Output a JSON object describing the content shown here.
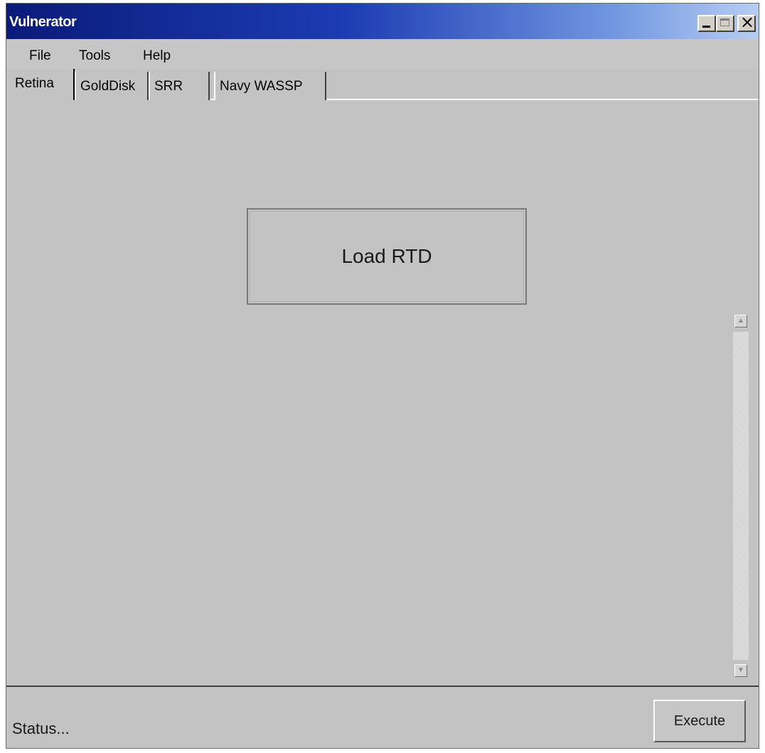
{
  "window": {
    "title": "Vulnerator",
    "controls": {
      "minimize": "minimize-icon",
      "maximize": "maximize-icon",
      "close": "close-icon"
    }
  },
  "menu": {
    "items": [
      {
        "label": "File"
      },
      {
        "label": "Tools"
      },
      {
        "label": "Help"
      }
    ]
  },
  "tabs": {
    "active": "Retina",
    "items": [
      {
        "label": "Retina"
      },
      {
        "label": "GoldDisk"
      },
      {
        "label": "SRR"
      },
      {
        "label": "Navy WASSP"
      }
    ]
  },
  "main": {
    "load_button_label": "Load RTD"
  },
  "status": {
    "text": "Status...",
    "execute_label": "Execute"
  },
  "colors": {
    "titlebar_start": "#0a1b7a",
    "titlebar_end": "#b7cdf2",
    "surface": "#c3c3c3"
  }
}
